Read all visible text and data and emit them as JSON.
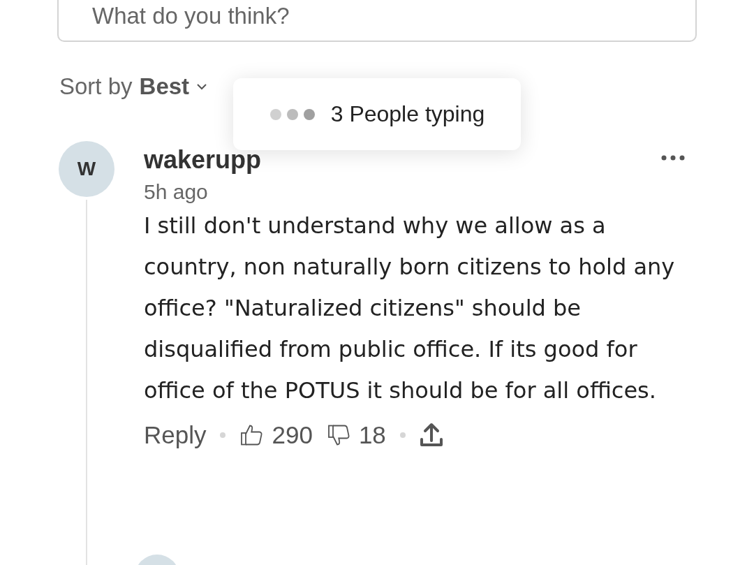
{
  "comment_field": {
    "placeholder": "What do you think?"
  },
  "sort": {
    "label": "Sort by",
    "value": "Best"
  },
  "typing_indicator": {
    "text": "3 People typing"
  },
  "comments": [
    {
      "avatar_letter": "W",
      "username": "wakerupp",
      "time": "5h ago",
      "body": "I still don't understand why we allow as a country, non naturally born citizens to hold any office? \"Naturalized citizens\" should be disqualified from public office. If its good for office of the POTUS it should be for all offices.",
      "reply": "Reply",
      "likes": "290",
      "dislikes": "18"
    }
  ]
}
